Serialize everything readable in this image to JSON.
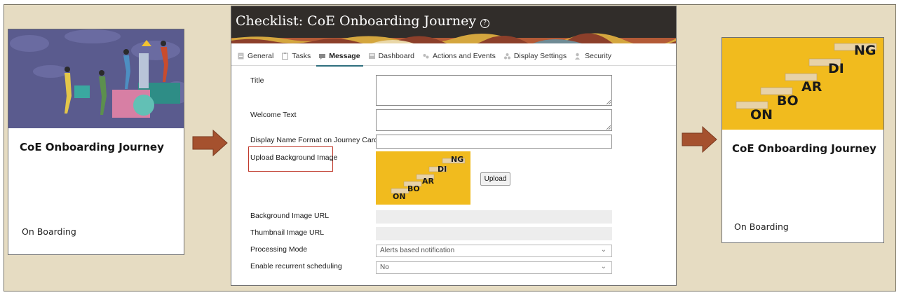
{
  "left_card": {
    "title": "CoE Onboarding Journey",
    "category": "On Boarding"
  },
  "right_card": {
    "title": "CoE Onboarding Journey",
    "category": "On Boarding",
    "image_steps": [
      "ON",
      "BO",
      "AR",
      "DI",
      "NG"
    ]
  },
  "dialog": {
    "title": "Checklist: CoE Onboarding Journey",
    "help_icon": "?",
    "tabs": [
      {
        "label": "General",
        "icon": "doc-icon"
      },
      {
        "label": "Tasks",
        "icon": "clipboard-icon"
      },
      {
        "label": "Message",
        "icon": "message-icon",
        "active": true
      },
      {
        "label": "Dashboard",
        "icon": "dashboard-icon"
      },
      {
        "label": "Actions and Events",
        "icon": "events-icon"
      },
      {
        "label": "Display Settings",
        "icon": "display-icon"
      },
      {
        "label": "Security",
        "icon": "security-icon"
      }
    ],
    "fields": {
      "title_label": "Title",
      "welcome_label": "Welcome Text",
      "display_name_label": "Display Name Format on Journey Card",
      "upload_label": "Upload Background Image",
      "bg_url_label": "Background Image URL",
      "thumb_url_label": "Thumbnail Image URL",
      "processing_label": "Processing Mode",
      "processing_value": "Alerts based notification",
      "recurrent_label": "Enable recurrent scheduling",
      "recurrent_value": "No"
    },
    "upload_button": "Upload",
    "thumb_steps": [
      "ON",
      "BO",
      "AR",
      "DI",
      "NG"
    ]
  },
  "colors": {
    "frame_bg": "#e6dcc2",
    "header_bg": "#312d2a",
    "arrow": "#a5512e",
    "highlight": "#c0392b",
    "yellow": "#f1bb1e",
    "active_tab": "#2f6f7e"
  }
}
